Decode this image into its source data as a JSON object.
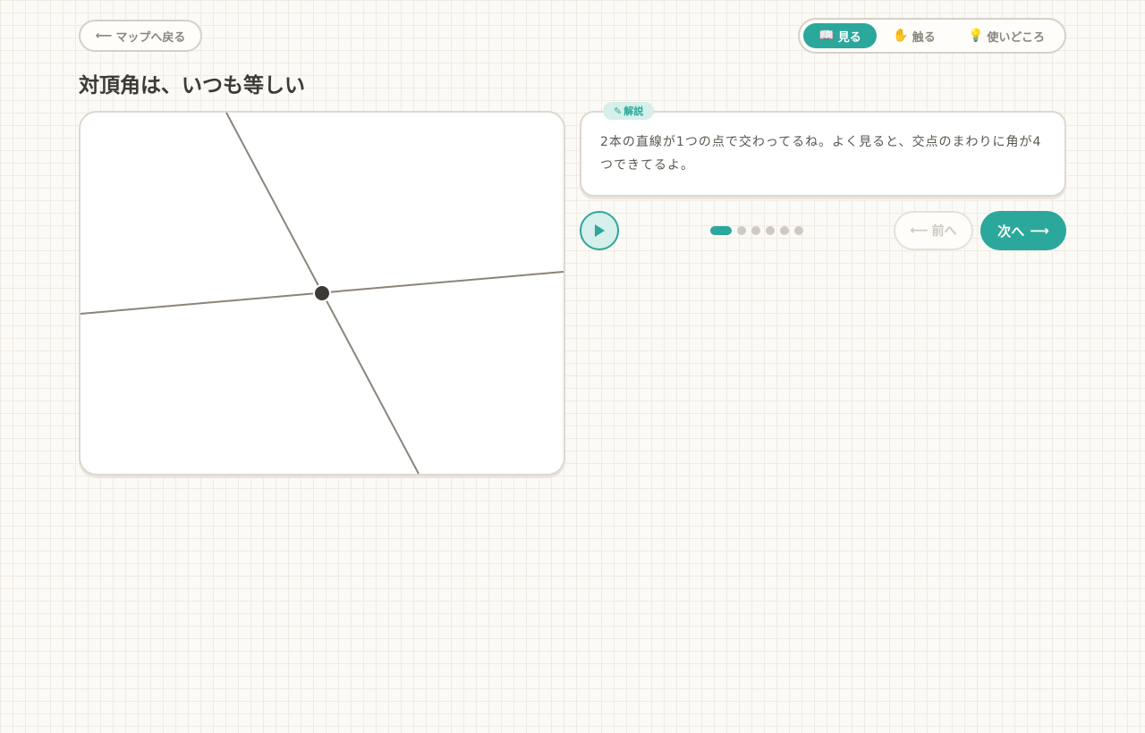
{
  "nav": {
    "back_label": "マップへ戻る",
    "back_icon": "left-arrow-icon"
  },
  "modes": [
    {
      "label": "見る",
      "icon": "book-icon",
      "active": true
    },
    {
      "label": "触る",
      "icon": "hand-icon",
      "active": false
    },
    {
      "label": "使いどころ",
      "icon": "lightbulb-icon",
      "active": false
    }
  ],
  "title": "対頂角は、いつも等しい",
  "explanation": {
    "badge": "解説",
    "badge_icon": "pencil-icon",
    "text": "2本の直線が1つの点で交わってるね。よく見ると、交点のまわりに角が4つできてるよ。"
  },
  "player": {
    "play_icon": "play-icon",
    "step_current": 1,
    "step_total": 6
  },
  "pager": {
    "prev_label": "前へ",
    "next_label": "次へ",
    "prev_enabled": false
  },
  "colors": {
    "accent": "#2ba89b",
    "accent_light": "#d6efeb",
    "line": "#8c847a",
    "point": "#3d3a35"
  }
}
